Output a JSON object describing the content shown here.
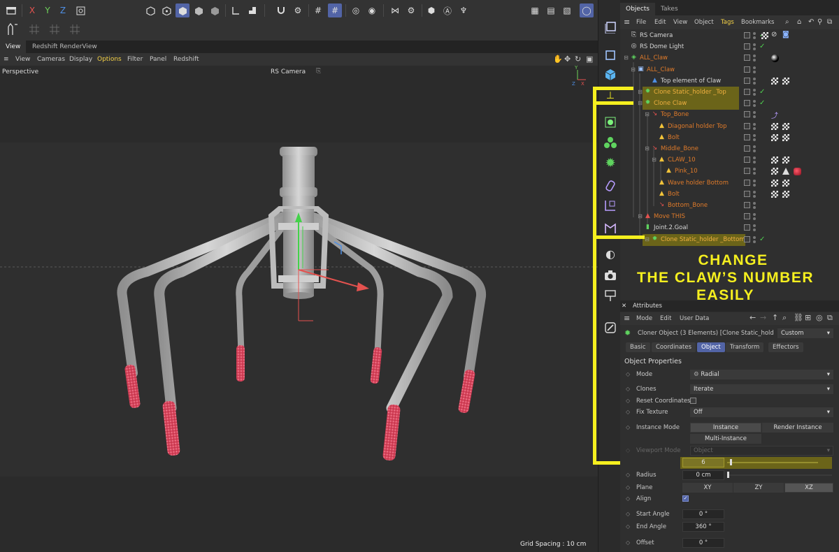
{
  "toolbar": {
    "axis_x": "X",
    "axis_y": "Y",
    "axis_z": "Z",
    "colors": {
      "x": "#e4524f",
      "y": "#6fd35a",
      "z": "#4f8fe4",
      "accent": "#5264a6"
    }
  },
  "viewport": {
    "tabs": [
      "View",
      "Redshift RenderView"
    ],
    "menu": [
      "View",
      "Cameras",
      "Display",
      "Options",
      "Filter",
      "Panel",
      "Redshift"
    ],
    "projection": "Perspective",
    "camera": "RS Camera",
    "grid_spacing": "Grid Spacing : 10 cm"
  },
  "objects": {
    "tabs": [
      "Objects",
      "Takes"
    ],
    "menu": [
      "File",
      "Edit",
      "View",
      "Object",
      "Tags",
      "Bookmarks"
    ],
    "rows": [
      {
        "name": "RS Camera",
        "color": "#d8d8d8"
      },
      {
        "name": "RS Dome Light",
        "color": "#d8d8d8"
      },
      {
        "name": "ALL_Claw",
        "color": "#e07b2a"
      },
      {
        "name": "ALL_Claw",
        "color": "#e07b2a"
      },
      {
        "name": "Top element of Claw",
        "color": "#d8d8d8"
      },
      {
        "name": "Clone Static_holder _Top",
        "color": "#f0b040"
      },
      {
        "name": "Clone Claw",
        "color": "#f0b040"
      },
      {
        "name": "Top_Bone",
        "color": "#e07b2a"
      },
      {
        "name": "Diagonal  holder Top",
        "color": "#e07b2a"
      },
      {
        "name": "Bolt",
        "color": "#e07b2a"
      },
      {
        "name": "Middle_Bone",
        "color": "#e07b2a"
      },
      {
        "name": "CLAW_10",
        "color": "#e07b2a"
      },
      {
        "name": "Pink_10",
        "color": "#e07b2a"
      },
      {
        "name": "Wave holder Bottom",
        "color": "#e07b2a"
      },
      {
        "name": "Bolt",
        "color": "#e07b2a"
      },
      {
        "name": "Bottom_Bone",
        "color": "#e07b2a"
      },
      {
        "name": "Move THIS",
        "color": "#e07b2a"
      },
      {
        "name": "Joint.2.Goal",
        "color": "#d8d8d8"
      },
      {
        "name": "Clone Static_holder _Bottom",
        "color": "#f0b040"
      }
    ]
  },
  "annotation": {
    "line1": "CHANGE",
    "line2": "THE CLAW’S NUMBER",
    "line3": "EASILY",
    "color": "#f5ef1f"
  },
  "attributes": {
    "title": "Attributes",
    "menu": [
      "Mode",
      "Edit",
      "User Data"
    ],
    "object_label": "Cloner Object (3 Elements) [Clone Static_holder ...",
    "layout": "Custom",
    "tabs": [
      "Basic",
      "Coordinates",
      "Object",
      "Transform",
      "Effectors"
    ],
    "active_tab": "Object",
    "section": "Object Properties",
    "mode_label": "Mode",
    "mode_value": "Radial",
    "clones_label": "Clones",
    "clones_value": "Iterate",
    "reset_label": "Reset Coordinates",
    "fix_label": "Fix Texture",
    "fix_value": "Off",
    "instance_label": "Instance Mode",
    "instance_options": [
      "Instance",
      "Render Instance",
      "Multi-Instance"
    ],
    "viewport_mode_label": "Viewport Mode",
    "viewport_mode_value": "Object",
    "count_value": "6",
    "radius_label": "Radius",
    "radius_value": "0 cm",
    "plane_label": "Plane",
    "plane_options": [
      "XY",
      "ZY",
      "XZ"
    ],
    "plane_selected": "XZ",
    "align_label": "Align",
    "align_checked": true,
    "start_angle_label": "Start Angle",
    "start_angle_value": "0 °",
    "end_angle_label": "End Angle",
    "end_angle_value": "360 °",
    "offset_label": "Offset",
    "offset_value": "0 °"
  }
}
